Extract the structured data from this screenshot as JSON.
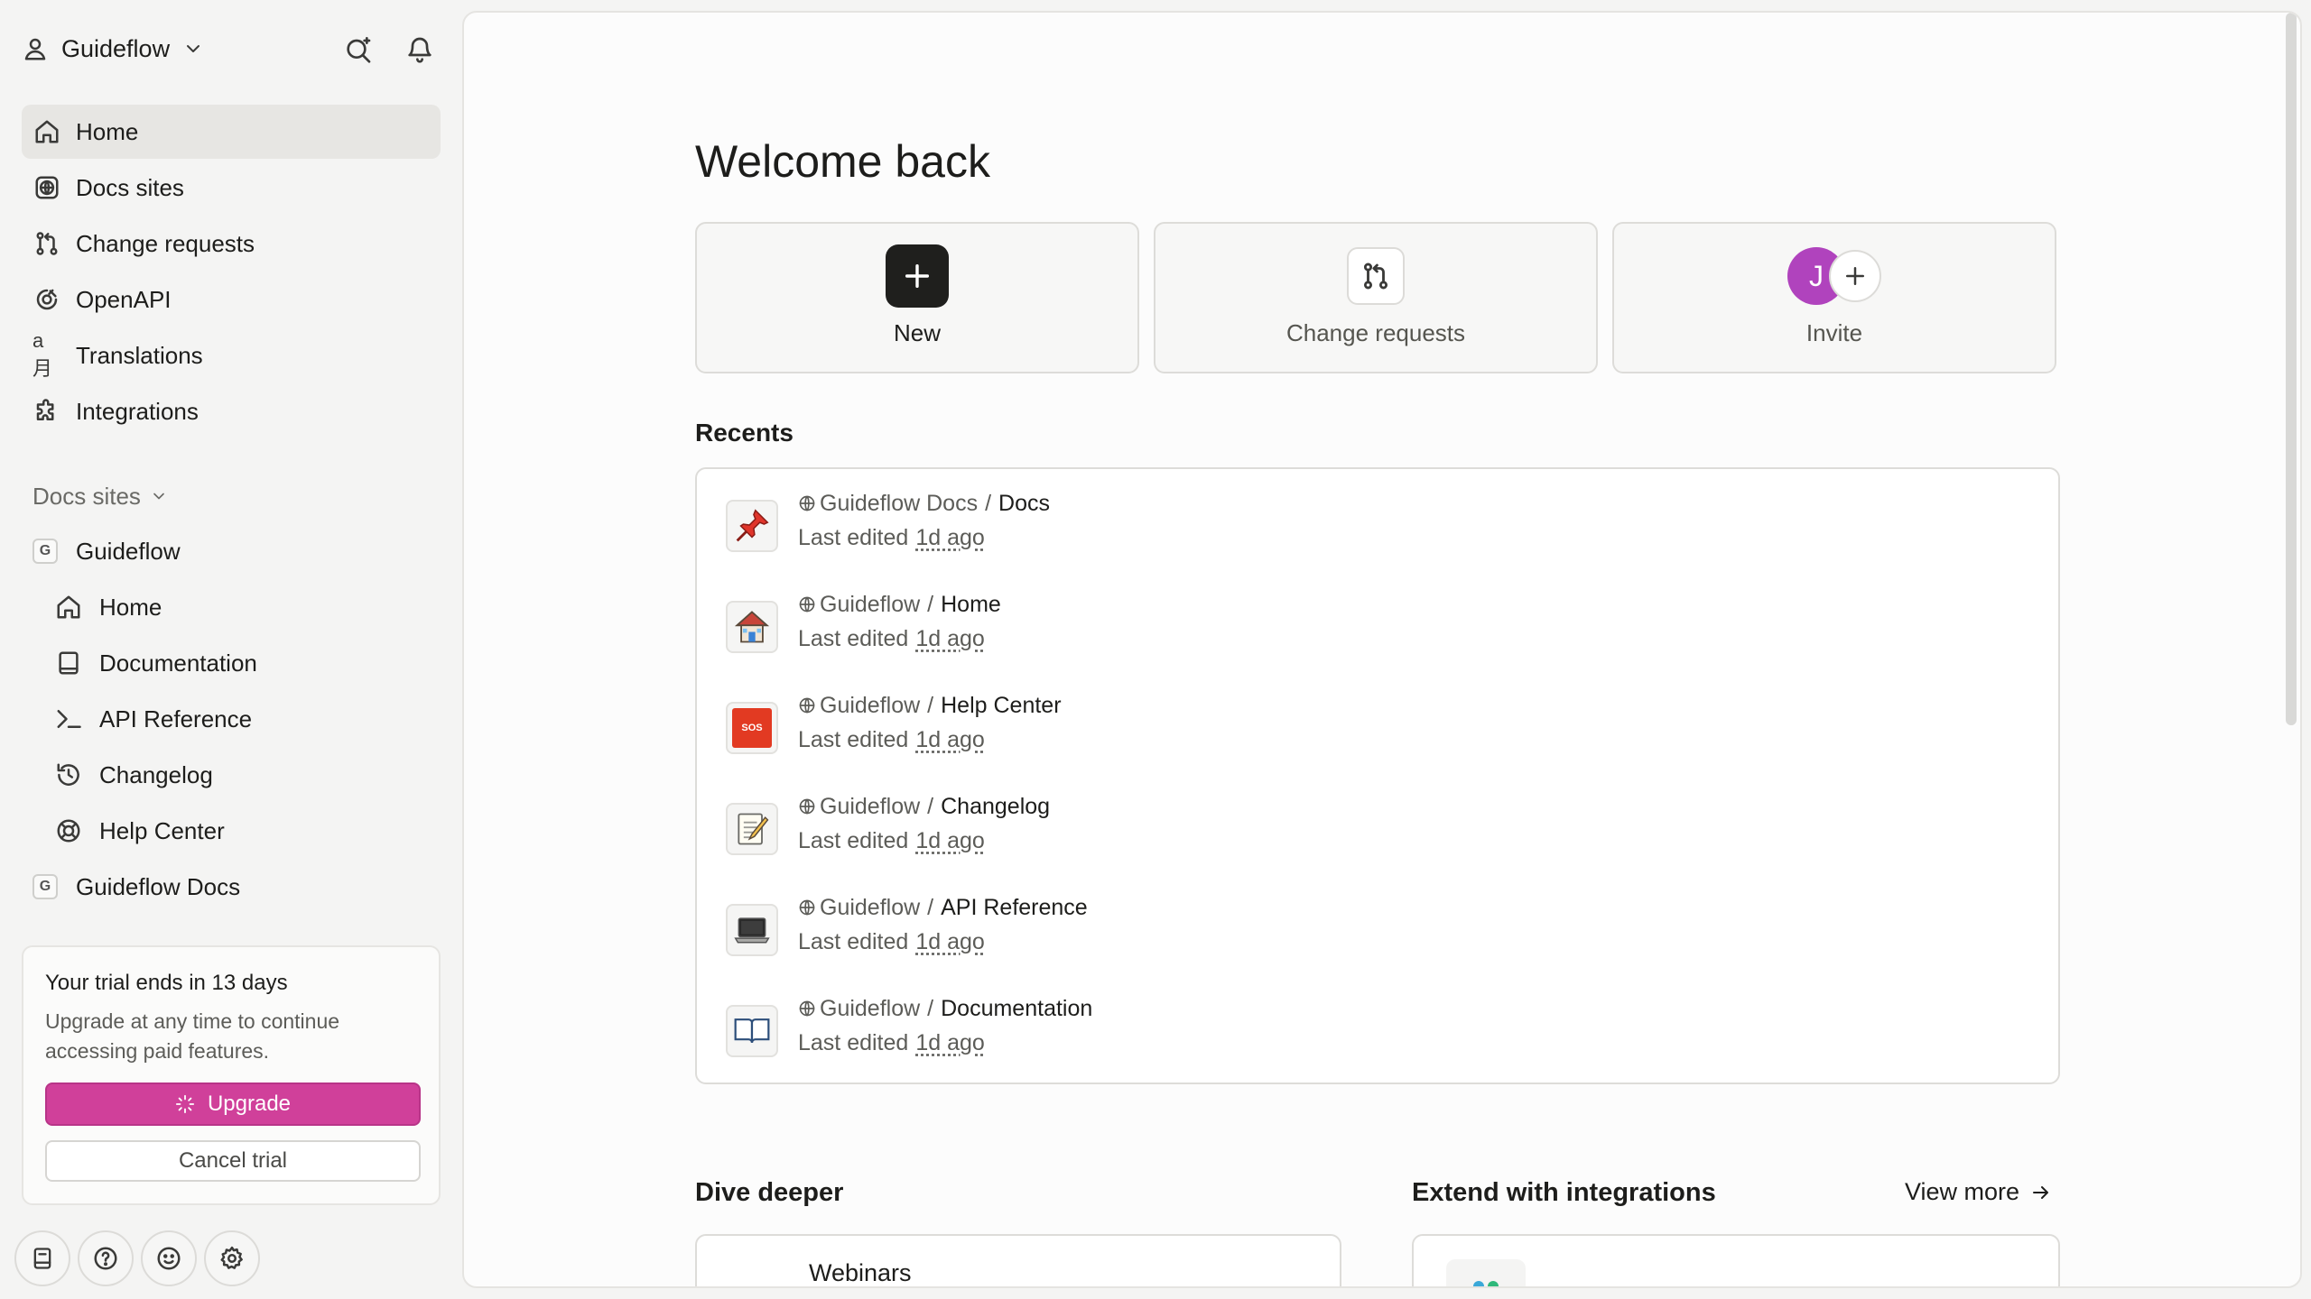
{
  "org": {
    "name": "Guideflow"
  },
  "nav": [
    {
      "label": "Home",
      "icon": "home-icon",
      "active": true
    },
    {
      "label": "Docs sites",
      "icon": "globe-icon"
    },
    {
      "label": "Change requests",
      "icon": "git-branch-icon"
    },
    {
      "label": "OpenAPI",
      "icon": "openapi-icon"
    },
    {
      "label": "Translations",
      "icon": "translate-icon",
      "glyph": "a月"
    },
    {
      "label": "Integrations",
      "icon": "puzzle-icon"
    }
  ],
  "sites_section": {
    "label": "Docs sites",
    "sites": [
      {
        "badge": "G",
        "name": "Guideflow",
        "children": [
          {
            "label": "Home",
            "icon": "home-icon"
          },
          {
            "label": "Documentation",
            "icon": "book-icon"
          },
          {
            "label": "API Reference",
            "icon": "terminal-icon"
          },
          {
            "label": "Changelog",
            "icon": "history-icon"
          },
          {
            "label": "Help Center",
            "icon": "lifebuoy-icon"
          }
        ]
      },
      {
        "badge": "G",
        "name": "Guideflow Docs",
        "children": []
      }
    ]
  },
  "trial": {
    "title": "Your trial ends in 13 days",
    "description": "Upgrade at any time to continue accessing paid features.",
    "upgrade_label": "Upgrade",
    "cancel_label": "Cancel trial"
  },
  "main": {
    "welcome": "Welcome back",
    "actions": {
      "new": "New",
      "change_requests": "Change requests",
      "invite": "Invite",
      "avatar_initial": "J"
    },
    "recents_title": "Recents",
    "recents": [
      {
        "space": "Guideflow Docs",
        "page": "Docs",
        "edited_prefix": "Last edited",
        "edited": "1d ago",
        "icon": "pushpin-icon"
      },
      {
        "space": "Guideflow",
        "page": "Home",
        "edited_prefix": "Last edited",
        "edited": "1d ago",
        "icon": "house-icon"
      },
      {
        "space": "Guideflow",
        "page": "Help Center",
        "edited_prefix": "Last edited",
        "edited": "1d ago",
        "icon": "sos-icon",
        "glyph": "SOS"
      },
      {
        "space": "Guideflow",
        "page": "Changelog",
        "edited_prefix": "Last edited",
        "edited": "1d ago",
        "icon": "memo-icon"
      },
      {
        "space": "Guideflow",
        "page": "API Reference",
        "edited_prefix": "Last edited",
        "edited": "1d ago",
        "icon": "laptop-icon"
      },
      {
        "space": "Guideflow",
        "page": "Documentation",
        "edited_prefix": "Last edited",
        "edited": "1d ago",
        "icon": "open-book-icon"
      }
    ],
    "dive_deeper": {
      "title": "Dive deeper",
      "card_label": "Webinars"
    },
    "integrations": {
      "title": "Extend with integrations",
      "view_more": "View more"
    }
  },
  "colors": {
    "accent": "#d0409a",
    "avatar": "#b043bd",
    "new_button": "#1f1f1d"
  }
}
